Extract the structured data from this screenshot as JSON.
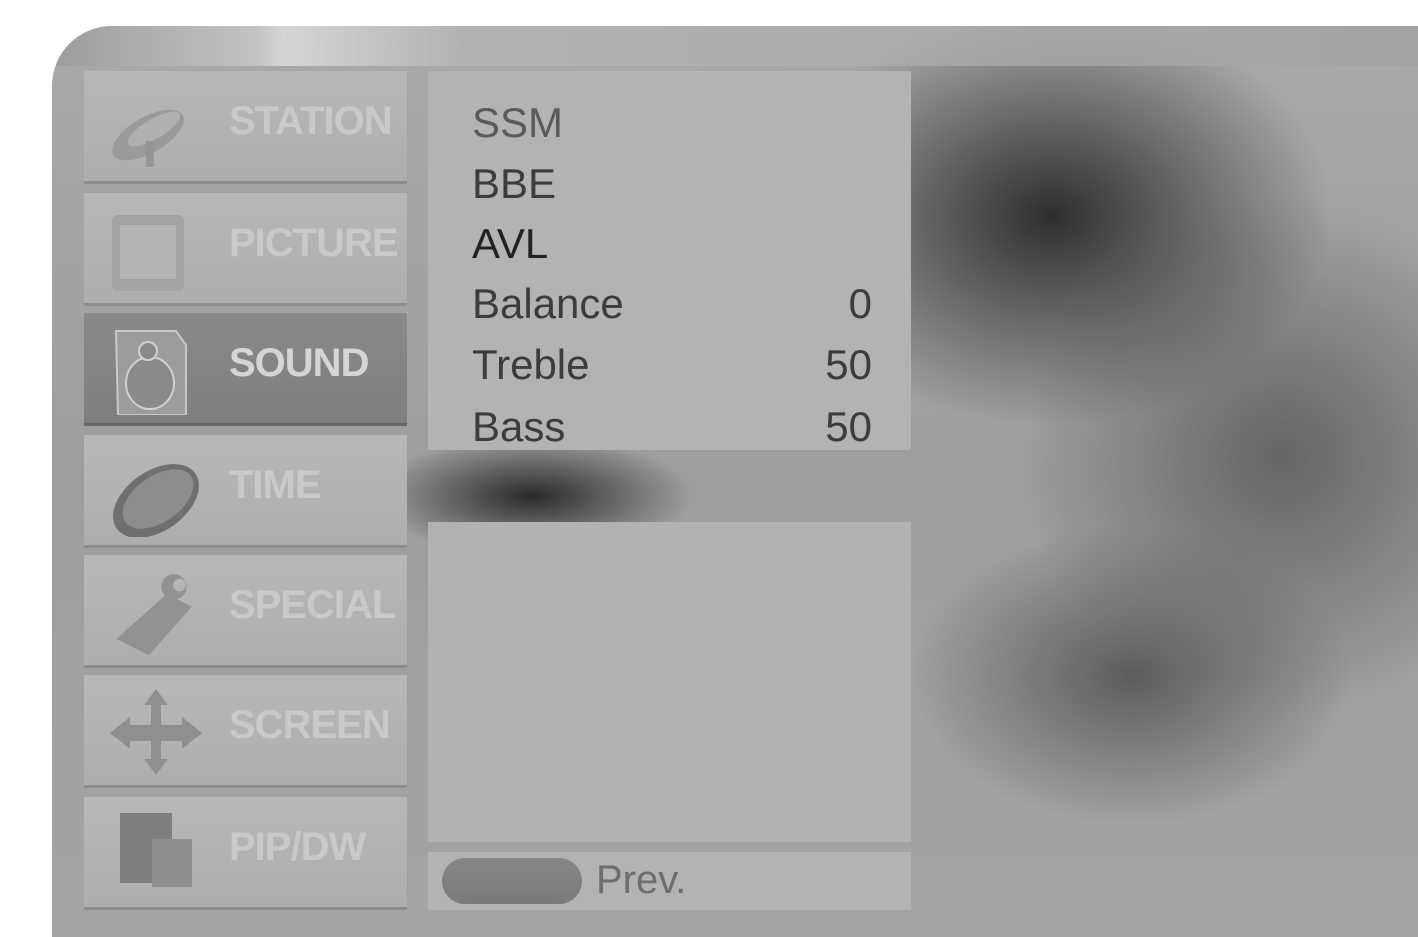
{
  "menu": {
    "items": [
      {
        "label": "STATION",
        "icon": "satellite-dish-icon",
        "selected": false
      },
      {
        "label": "PICTURE",
        "icon": "tv-icon",
        "selected": false
      },
      {
        "label": "SOUND",
        "icon": "speaker-icon",
        "selected": true
      },
      {
        "label": "TIME",
        "icon": "clock-icon",
        "selected": false
      },
      {
        "label": "SPECIAL",
        "icon": "tag-icon",
        "selected": false
      },
      {
        "label": "SCREEN",
        "icon": "move-arrows-icon",
        "selected": false
      },
      {
        "label": "PIP/DW",
        "icon": "pip-icon",
        "selected": false
      }
    ]
  },
  "sound": {
    "options": [
      {
        "label": "SSM",
        "value": ""
      },
      {
        "label": "BBE",
        "value": ""
      },
      {
        "label": "AVL",
        "value": ""
      },
      {
        "label": "Balance",
        "value": "0"
      },
      {
        "label": "Treble",
        "value": "50"
      },
      {
        "label": "Bass",
        "value": "50"
      }
    ]
  },
  "footer": {
    "prev_label": "Prev."
  },
  "colors": {
    "panel": "#b3b3b3",
    "selected_item": "#828282",
    "text_dark": "#3c3c3c"
  }
}
